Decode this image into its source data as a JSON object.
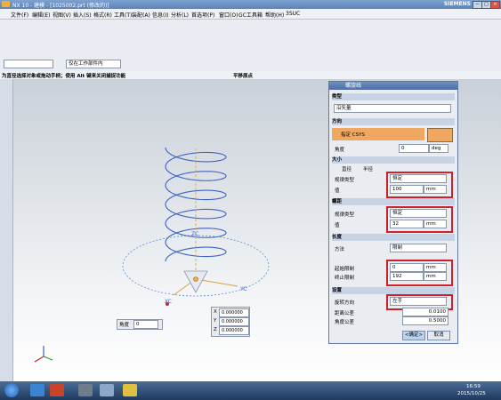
{
  "window": {
    "title": "NX 10 - 建模 - [1025002.prt (修改的)]",
    "brand": "SIEMENS",
    "controls": [
      "—",
      "□",
      "✕"
    ]
  },
  "menu": [
    "文件(F)",
    "编辑(E)",
    "视图(V)",
    "插入(S)",
    "格式(R)",
    "工具(T)",
    "装配(A)",
    "信息(I)",
    "分析(L)",
    "首选项(P)",
    "窗口(O)",
    "GC工具箱",
    "帮助(H)",
    "3SUC"
  ],
  "filter": {
    "left": "",
    "right": "仅在工作部件内"
  },
  "status": {
    "prompt": "为直径选择对象或拖动手柄；使用 Alt 键来关闭捕捉功能",
    "center": "平移原点"
  },
  "dialog": {
    "title": "螺旋线",
    "type_section": "类型",
    "type_value": "沿矢量",
    "direction_section": "方向",
    "csys_label": "指定 CSYS",
    "angle_label": "角度",
    "angle_value": "0",
    "angle_unit": "deg",
    "size_section": "大小",
    "radio_diameter": "直径",
    "radio_radius": "半径",
    "size_law_label": "规律类型",
    "size_law_value": "恒定",
    "size_value_label": "值",
    "size_value": "100",
    "size_unit": "mm",
    "pitch_section": "螺距",
    "pitch_law_label": "规律类型",
    "pitch_law_value": "恒定",
    "pitch_value_label": "值",
    "pitch_value": "32",
    "pitch_unit": "mm",
    "length_section": "长度",
    "method_label": "方法",
    "method_value": "限制",
    "start_label": "起始限制",
    "start_value": "0",
    "start_unit": "mm",
    "end_label": "终止限制",
    "end_value": "192",
    "end_unit": "mm",
    "settings_section": "设置",
    "rotation_label": "旋转方向",
    "rotation_value": "左手",
    "dist_tol_label": "距离公差",
    "dist_tol_value": "0.0100",
    "angle_tol_label": "角度公差",
    "angle_tol_value": "0.5000",
    "ok": "<确定>",
    "cancel": "取消"
  },
  "viewport": {
    "angle_label": "角度",
    "angle_value": "0",
    "coords": [
      {
        "axis": "X",
        "value": "0.000000"
      },
      {
        "axis": "Y",
        "value": "0.000000"
      },
      {
        "axis": "Z",
        "value": "0.000000"
      }
    ],
    "axes": {
      "x": "XC",
      "y": "YC",
      "z": "ZC"
    }
  },
  "taskbar": {
    "time": "16:59",
    "date": "2015/10/25"
  },
  "colors": {
    "helix": "#3a63c6",
    "highlight": "#d0202a",
    "csys": "#f0b03a"
  }
}
